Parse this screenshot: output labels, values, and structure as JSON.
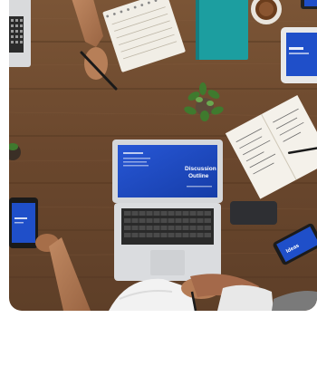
{
  "photo": {
    "laptop_screen": {
      "heading_line1": "Discussion",
      "heading_line2": "Outline"
    },
    "phone_screen": {
      "label": "Ideas"
    },
    "colors": {
      "table_wood": "#6b4a30",
      "screen_blue": "#1f4fc9",
      "notebook_teal": "#1c9ea0",
      "sleeve_white": "#f2f2f2"
    }
  }
}
